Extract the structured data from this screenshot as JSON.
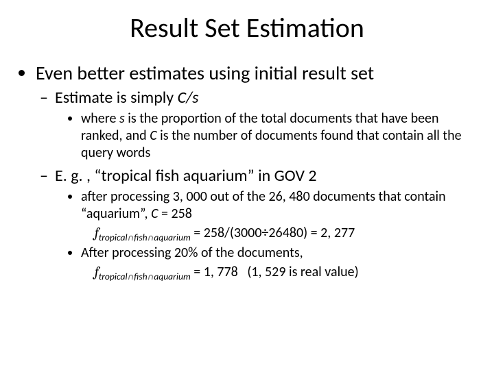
{
  "title": "Result Set Estimation",
  "b1": "Even better estimates using initial result set",
  "b1_1_pre": "Estimate is simply ",
  "b1_1_em": "C/s",
  "b1_1_1_a": "where ",
  "b1_1_1_s": "s",
  "b1_1_1_b": " is the proportion of the total documents that have been ranked, and ",
  "b1_1_1_c": "C",
  "b1_1_1_d": " is the number of documents found that contain all the query words",
  "b1_2": "E. g. , “tropical fish aquarium” in GOV 2",
  "b1_2_1_a": "after processing 3, 000 out of the 26, 480 documents that contain “aquarium”, ",
  "b1_2_1_b": "C",
  "b1_2_1_c": " = 258",
  "f1_f": "f",
  "f1_sub": "tropical∩fish∩aquarium",
  "f1_rhs": " = 258/(3000÷26480) = 2, 277",
  "b1_2_2": "After processing 20% of the documents,",
  "f2_f": "f",
  "f2_sub": "tropical∩fish∩aquarium",
  "f2_rhs": " = 1, 778   (1, 529 is real value)"
}
